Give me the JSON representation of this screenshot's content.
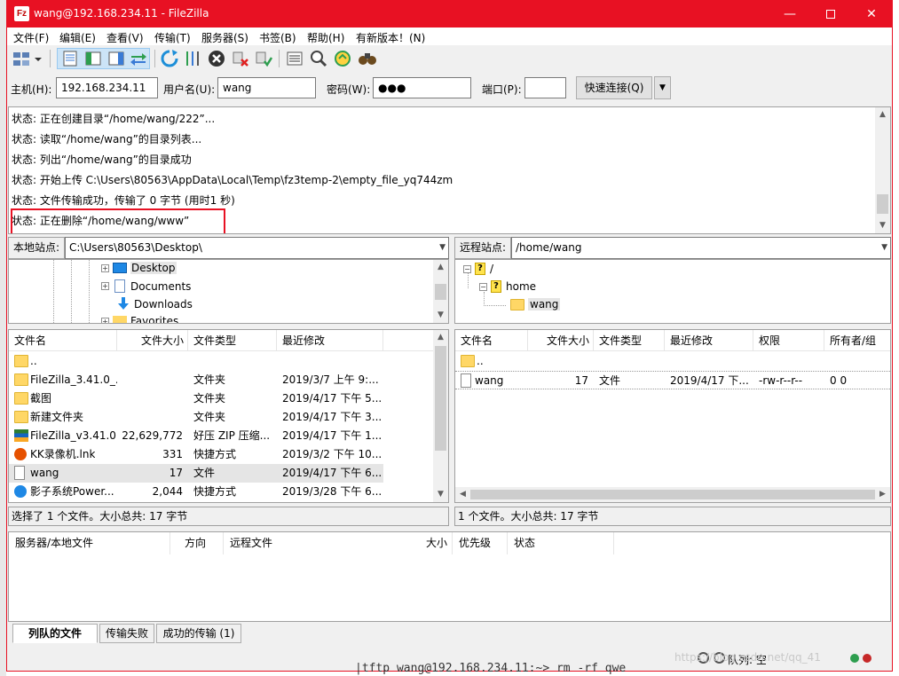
{
  "window": {
    "app_icon_text": "Fz",
    "title": "wang@192.168.234.11 - FileZilla",
    "minimize": "—",
    "close": "✕"
  },
  "menu": [
    "文件(F)",
    "编辑(E)",
    "查看(V)",
    "传输(T)",
    "服务器(S)",
    "书签(B)",
    "帮助(H)",
    "有新版本！(N)"
  ],
  "quickconnect": {
    "host_label": "主机(H):",
    "host_value": "192.168.234.11",
    "user_label": "用户名(U):",
    "user_value": "wang",
    "password_label": "密码(W):",
    "password_value": "●●●",
    "port_label": "端口(P):",
    "port_value": "",
    "connect_button": "快速连接(Q)",
    "dropdown": "▼"
  },
  "log": [
    "状态: 正在创建目录“/home/wang/222”...",
    "状态: 读取“/home/wang”的目录列表...",
    "状态: 列出“/home/wang”的目录成功",
    "状态: 开始上传 C:\\Users\\80563\\AppData\\Local\\Temp\\fz3temp-2\\empty_file_yq744zm",
    "状态: 文件传输成功，传输了 0 字节 (用时1 秒)",
    "状态: 正在删除“/home/wang/www”"
  ],
  "local": {
    "site_label": "本地站点:",
    "path": "C:\\Users\\80563\\Desktop\\",
    "tree": [
      "Desktop",
      "Documents",
      "Downloads",
      "Favorites"
    ],
    "columns": [
      "文件名",
      "文件大小",
      "文件类型",
      "最近修改"
    ],
    "files": [
      {
        "name": "..",
        "size": "",
        "type": "",
        "modified": ""
      },
      {
        "name": "FileZilla_3.41.0_...",
        "size": "",
        "type": "文件夹",
        "modified": "2019/3/7 上午 9:..."
      },
      {
        "name": "截图",
        "size": "",
        "type": "文件夹",
        "modified": "2019/4/17 下午 5..."
      },
      {
        "name": "新建文件夹",
        "size": "",
        "type": "文件夹",
        "modified": "2019/4/17 下午 3..."
      },
      {
        "name": "FileZilla_v3.41.0...",
        "size": "22,629,772",
        "type": "好压 ZIP 压缩...",
        "modified": "2019/4/17 下午 1..."
      },
      {
        "name": "KK录像机.lnk",
        "size": "331",
        "type": "快捷方式",
        "modified": "2019/3/2 下午 10..."
      },
      {
        "name": "wang",
        "size": "17",
        "type": "文件",
        "modified": "2019/4/17 下午 6..."
      },
      {
        "name": "影子系统Power...",
        "size": "2,044",
        "type": "快捷方式",
        "modified": "2019/3/28 下午 6..."
      }
    ],
    "status": "选择了 1 个文件。大小总共: 17 字节"
  },
  "remote": {
    "site_label": "远程站点:",
    "path": "/home/wang",
    "tree": [
      "/",
      "home",
      "wang"
    ],
    "columns": [
      "文件名",
      "文件大小",
      "文件类型",
      "最近修改",
      "权限",
      "所有者/组"
    ],
    "files": [
      {
        "name": "..",
        "size": "",
        "type": "",
        "modified": "",
        "perm": "",
        "owner": ""
      },
      {
        "name": "wang",
        "size": "17",
        "type": "文件",
        "modified": "2019/4/17 下...",
        "perm": "-rw-r--r--",
        "owner": "0 0"
      }
    ],
    "status": "1 个文件。大小总共: 17 字节"
  },
  "queue": {
    "columns": [
      "服务器/本地文件",
      "方向",
      "远程文件",
      "大小",
      "优先级",
      "状态"
    ],
    "tabs": [
      "列队的文件",
      "传输失败",
      "成功的传输 (1)"
    ],
    "status": "队列: 空"
  },
  "outside_text": "|tftp wang@192.168.234.11:~> rm -rf qwe",
  "watermark": "https://blog.csdn.net/qq_41"
}
